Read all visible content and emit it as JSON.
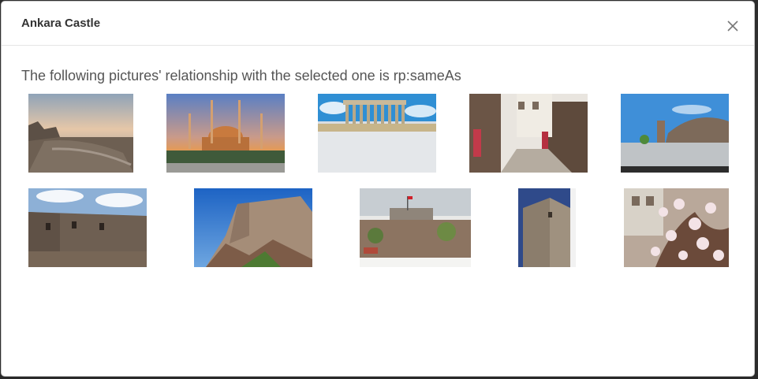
{
  "modal": {
    "title": "Ankara Castle",
    "close_icon": "close-icon",
    "subtitle": "The following pictures' relationship with the selected one is rp:sameAs"
  },
  "gallery": {
    "items": [
      {
        "id": "castle-wall-sunset"
      },
      {
        "id": "mosque-sunset"
      },
      {
        "id": "anitkabir-mausoleum"
      },
      {
        "id": "old-town-street"
      },
      {
        "id": "castle-tower-plaza"
      },
      {
        "id": "castle-ruins-interior"
      },
      {
        "id": "castle-cliff-rampart"
      },
      {
        "id": "castle-hill-city-view"
      },
      {
        "id": "stone-tower"
      },
      {
        "id": "blossom-over-houses"
      }
    ]
  }
}
